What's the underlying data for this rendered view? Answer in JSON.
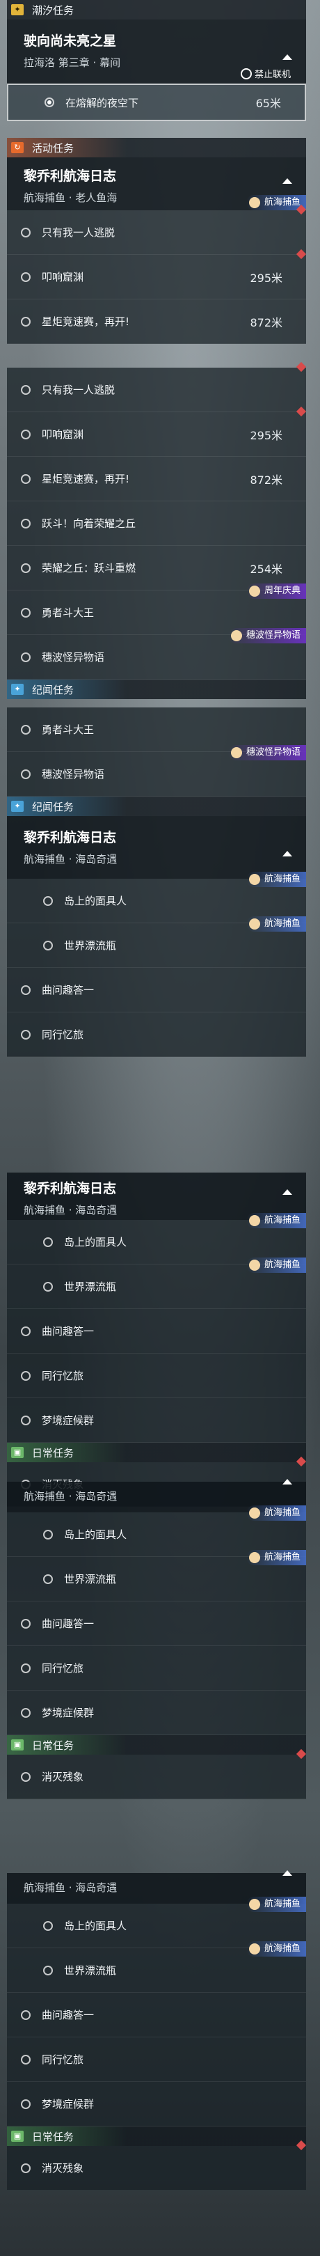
{
  "tide": {
    "category": "潮汐任务",
    "title": "驶向尚未亮之星",
    "subtitle": "拉海洛 第三章 · 幕间",
    "sub_item": "在熔解的夜空下",
    "distance": "65米",
    "ban_label": "禁止联机"
  },
  "activity": {
    "category": "活动任务",
    "title": "黎乔利航海日志",
    "subtitle": "航海捕鱼 · 老人鱼海",
    "tag": "航海捕鱼"
  },
  "legend": {
    "category": "纪闻任务"
  },
  "daily": {
    "category": "日常任务",
    "item": "消灭残象"
  },
  "items": {
    "alone": "只有我一人逃脱",
    "ring": "叩响窟渊",
    "star": "星炬竞速赛，再开!",
    "jump": "跃斗！向着荣耀之丘",
    "glory": "荣耀之丘：跃斗重燃",
    "brave": "勇者斗大王",
    "wave": "穗波怪异物语"
  },
  "dist": {
    "ring": "295米",
    "star": "872米",
    "glory": "254米"
  },
  "tags": {
    "anniv": "周年庆典",
    "wave": "穗波怪异物语",
    "fish": "航海捕鱼"
  },
  "legend_quest": {
    "title": "黎乔利航海日志",
    "subtitle": "航海捕鱼 · 海岛奇遇",
    "i1": "岛上的面具人",
    "i2": "世界漂流瓶",
    "i3": "曲问趣答一",
    "i4": "同行忆旅",
    "i5": "梦境症候群"
  }
}
